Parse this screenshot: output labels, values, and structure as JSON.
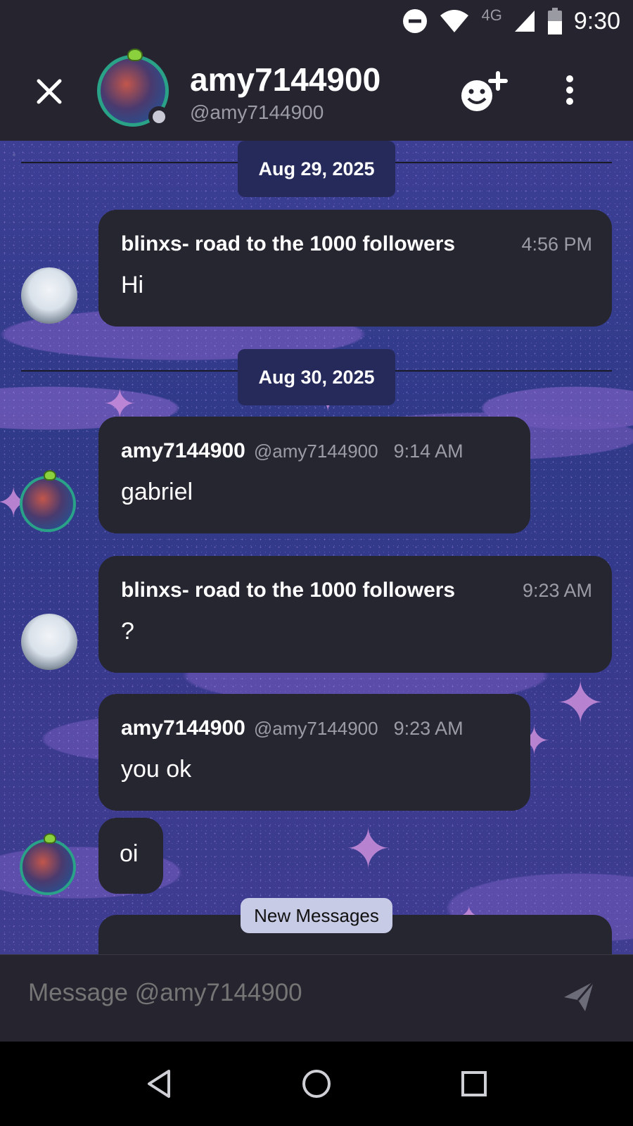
{
  "status_bar": {
    "time": "9:30",
    "network": "4G",
    "icons": [
      "do-not-disturb-icon",
      "wifi-icon",
      "signal-icon",
      "battery-icon"
    ]
  },
  "header": {
    "name": "amy7144900",
    "handle": "@amy7144900",
    "icons": [
      "close-icon",
      "add-friend-icon",
      "more-vertical-icon"
    ]
  },
  "chat": {
    "dates": [
      "Aug 29, 2025",
      "Aug 30, 2025"
    ],
    "messages": [
      {
        "author": "blinxs- road to the 1000 followers",
        "time": "4:56 PM",
        "text": "Hi"
      },
      {
        "author": "amy7144900",
        "handle": "@amy7144900",
        "time": "9:14 AM",
        "text": "gabriel"
      },
      {
        "author": "blinxs- road to the 1000 followers",
        "time": "9:23 AM",
        "text": "?"
      },
      {
        "author": "amy7144900",
        "handle": "@amy7144900",
        "time": "9:23 AM",
        "text": "you ok"
      },
      {
        "text": "oi"
      }
    ],
    "new_messages_label": "New Messages"
  },
  "composer": {
    "placeholder": "Message @amy7144900",
    "send_icon": "send-icon"
  },
  "navbar": {
    "icons": [
      "back-icon",
      "home-icon",
      "recents-icon"
    ]
  },
  "colors": {
    "background": "#25242f",
    "bubble": "#262630",
    "accent_ring": "#2aa288",
    "pill": "#c8cbe6"
  }
}
